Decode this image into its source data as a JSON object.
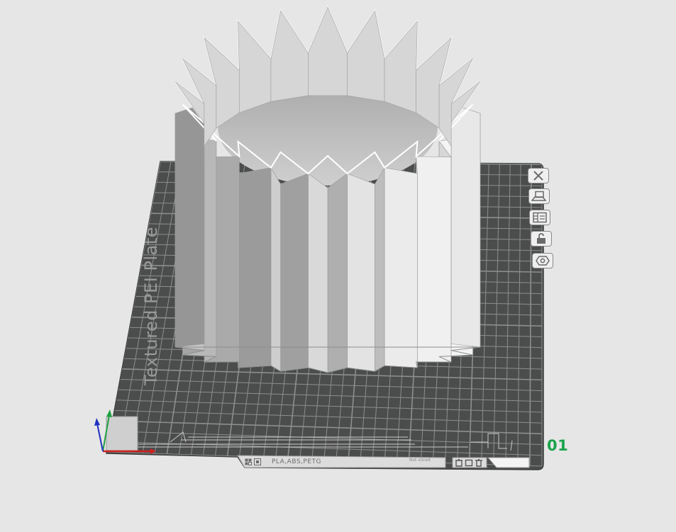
{
  "app": {
    "view": "3D Prepare view"
  },
  "plate": {
    "number": "01",
    "texture_label": "Textured PEI Plate",
    "filament_label": "PLA,ABS,PETG",
    "status_label": "Not sliced"
  },
  "plate_toolbar": [
    {
      "name": "remove-plate-button",
      "icon": "close-icon"
    },
    {
      "name": "arrange-plate-button",
      "icon": "arrange-icon"
    },
    {
      "name": "plate-settings-button",
      "icon": "plate-settings-icon"
    },
    {
      "name": "lock-plate-button",
      "icon": "lock-icon"
    },
    {
      "name": "plate-name-button",
      "icon": "nut-icon"
    }
  ],
  "colors": {
    "background": "#e6e6e6",
    "plate": "#4b4d4c",
    "grid": "#8d8f8e",
    "model_light": "#f2f2f2",
    "model_dark": "#8a8a8a",
    "plate_number": "#1aa34a",
    "axis_x": "#d02020",
    "axis_y": "#20a040",
    "axis_z": "#2030c0"
  }
}
